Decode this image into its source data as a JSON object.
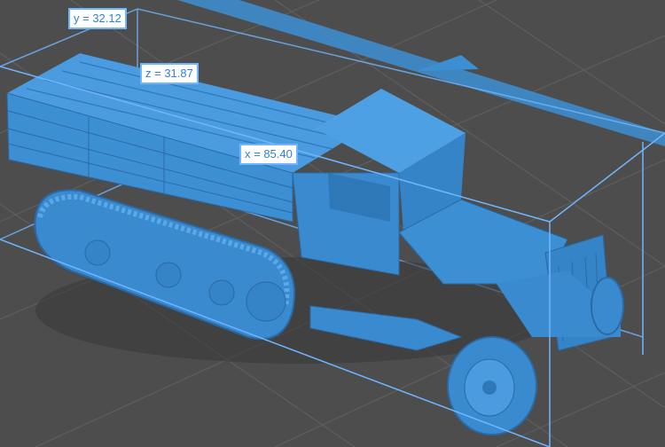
{
  "viewport": {
    "background_color": "#4d4d4d",
    "grid_color": "#5e5e5e",
    "model_color": "#3d8fd4",
    "model_shadow_color": "#2a6aa6",
    "bounding_box_color": "#6fb6ff"
  },
  "dimensions": {
    "x_label": "x = 85.40",
    "y_label": "y = 32.12",
    "z_label": "z = 31.87"
  },
  "model": {
    "icon": "halftrack-truck-3d-model"
  }
}
